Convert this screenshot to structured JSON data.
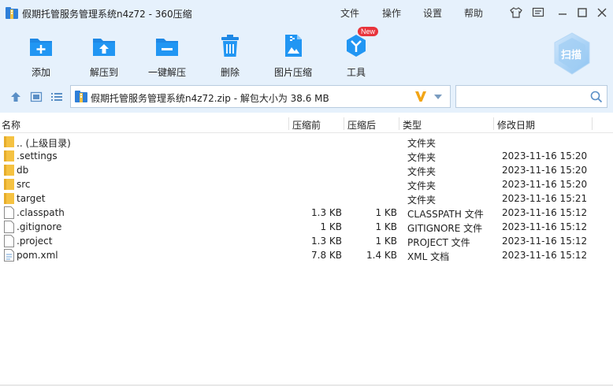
{
  "window": {
    "title": "假期托管服务管理系统n4z72 - 360压缩"
  },
  "menu": {
    "file": "文件",
    "operate": "操作",
    "settings": "设置",
    "help": "帮助"
  },
  "toolbar": {
    "add": "添加",
    "extract_to": "解压到",
    "one_click_extract": "一键解压",
    "delete": "删除",
    "image_compress": "图片压缩",
    "tools": "工具",
    "new_badge": "New",
    "scan": "扫描"
  },
  "address": {
    "path": "假期托管服务管理系统n4z72.zip - 解包大小为 38.6 MB",
    "search_placeholder": ""
  },
  "columns": {
    "name": "名称",
    "size": "压缩前",
    "compressed": "压缩后",
    "type": "类型",
    "modified": "修改日期"
  },
  "files": [
    {
      "name": ".. (上级目录)",
      "size": "",
      "compressed": "",
      "type": "文件夹",
      "modified": "",
      "kind": "folder"
    },
    {
      "name": ".settings",
      "size": "",
      "compressed": "",
      "type": "文件夹",
      "modified": "2023-11-16 15:20",
      "kind": "folder"
    },
    {
      "name": "db",
      "size": "",
      "compressed": "",
      "type": "文件夹",
      "modified": "2023-11-16 15:20",
      "kind": "folder"
    },
    {
      "name": "src",
      "size": "",
      "compressed": "",
      "type": "文件夹",
      "modified": "2023-11-16 15:20",
      "kind": "folder"
    },
    {
      "name": "target",
      "size": "",
      "compressed": "",
      "type": "文件夹",
      "modified": "2023-11-16 15:21",
      "kind": "folder"
    },
    {
      "name": ".classpath",
      "size": "1.3 KB",
      "compressed": "1 KB",
      "type": "CLASSPATH 文件",
      "modified": "2023-11-16 15:12",
      "kind": "file"
    },
    {
      "name": ".gitignore",
      "size": "1 KB",
      "compressed": "1 KB",
      "type": "GITIGNORE 文件",
      "modified": "2023-11-16 15:12",
      "kind": "file"
    },
    {
      "name": ".project",
      "size": "1.3 KB",
      "compressed": "1 KB",
      "type": "PROJECT 文件",
      "modified": "2023-11-16 15:12",
      "kind": "file"
    },
    {
      "name": "pom.xml",
      "size": "7.8 KB",
      "compressed": "1.4 KB",
      "type": "XML 文档",
      "modified": "2023-11-16 15:12",
      "kind": "xml"
    }
  ],
  "colors": {
    "chrome_bg": "#e6f1fc",
    "accent_blue": "#1e88e5",
    "folder_yellow": "#f5c242",
    "badge_red": "#e8343c"
  }
}
